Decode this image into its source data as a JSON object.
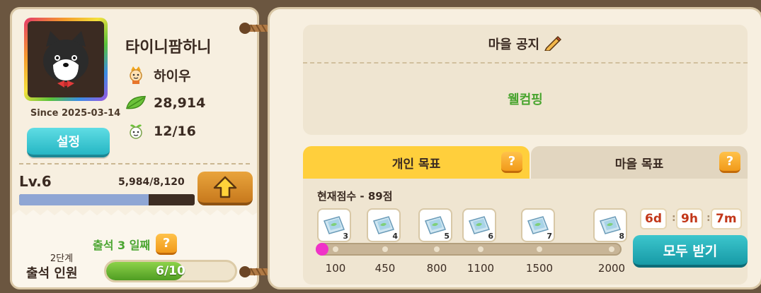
{
  "profile": {
    "nickname": "타이니팜하니",
    "since": "Since 2025-03-14",
    "settings_label": "설정",
    "friend_name": "하이우",
    "leaf_count": "28,914",
    "villagers": "12/16",
    "level": "Lv.6",
    "xp_text": "5,984/8,120",
    "xp_fraction": 0.737
  },
  "attendance": {
    "title": "출석 3 일째",
    "help": "?",
    "stage": "2단계",
    "count_label": "출석 인원",
    "progress_text": "6/10",
    "progress_fraction": 0.6
  },
  "notice": {
    "title": "마을 공지",
    "body": "웰컴핑"
  },
  "goals": {
    "tabs": [
      {
        "label": "개인 목표",
        "active": true
      },
      {
        "label": "마을 목표",
        "active": false
      }
    ],
    "score_label": "현재점수 - 89점",
    "score": 89,
    "milestones": [
      {
        "value": "100",
        "reward_count": "3"
      },
      {
        "value": "450",
        "reward_count": "4"
      },
      {
        "value": "800",
        "reward_count": "5"
      },
      {
        "value": "1100",
        "reward_count": "6"
      },
      {
        "value": "1500",
        "reward_count": "7"
      },
      {
        "value": "2000",
        "reward_count": "8"
      }
    ],
    "timer": {
      "days": "6d",
      "hours": "9h",
      "minutes": "7m"
    },
    "claim_all_label": "모두 받기"
  },
  "colors": {
    "accent_green": "#4aa530",
    "accent_teal": "#26b6c4",
    "accent_orange": "#f19a1a",
    "timer_red": "#c2371a"
  }
}
